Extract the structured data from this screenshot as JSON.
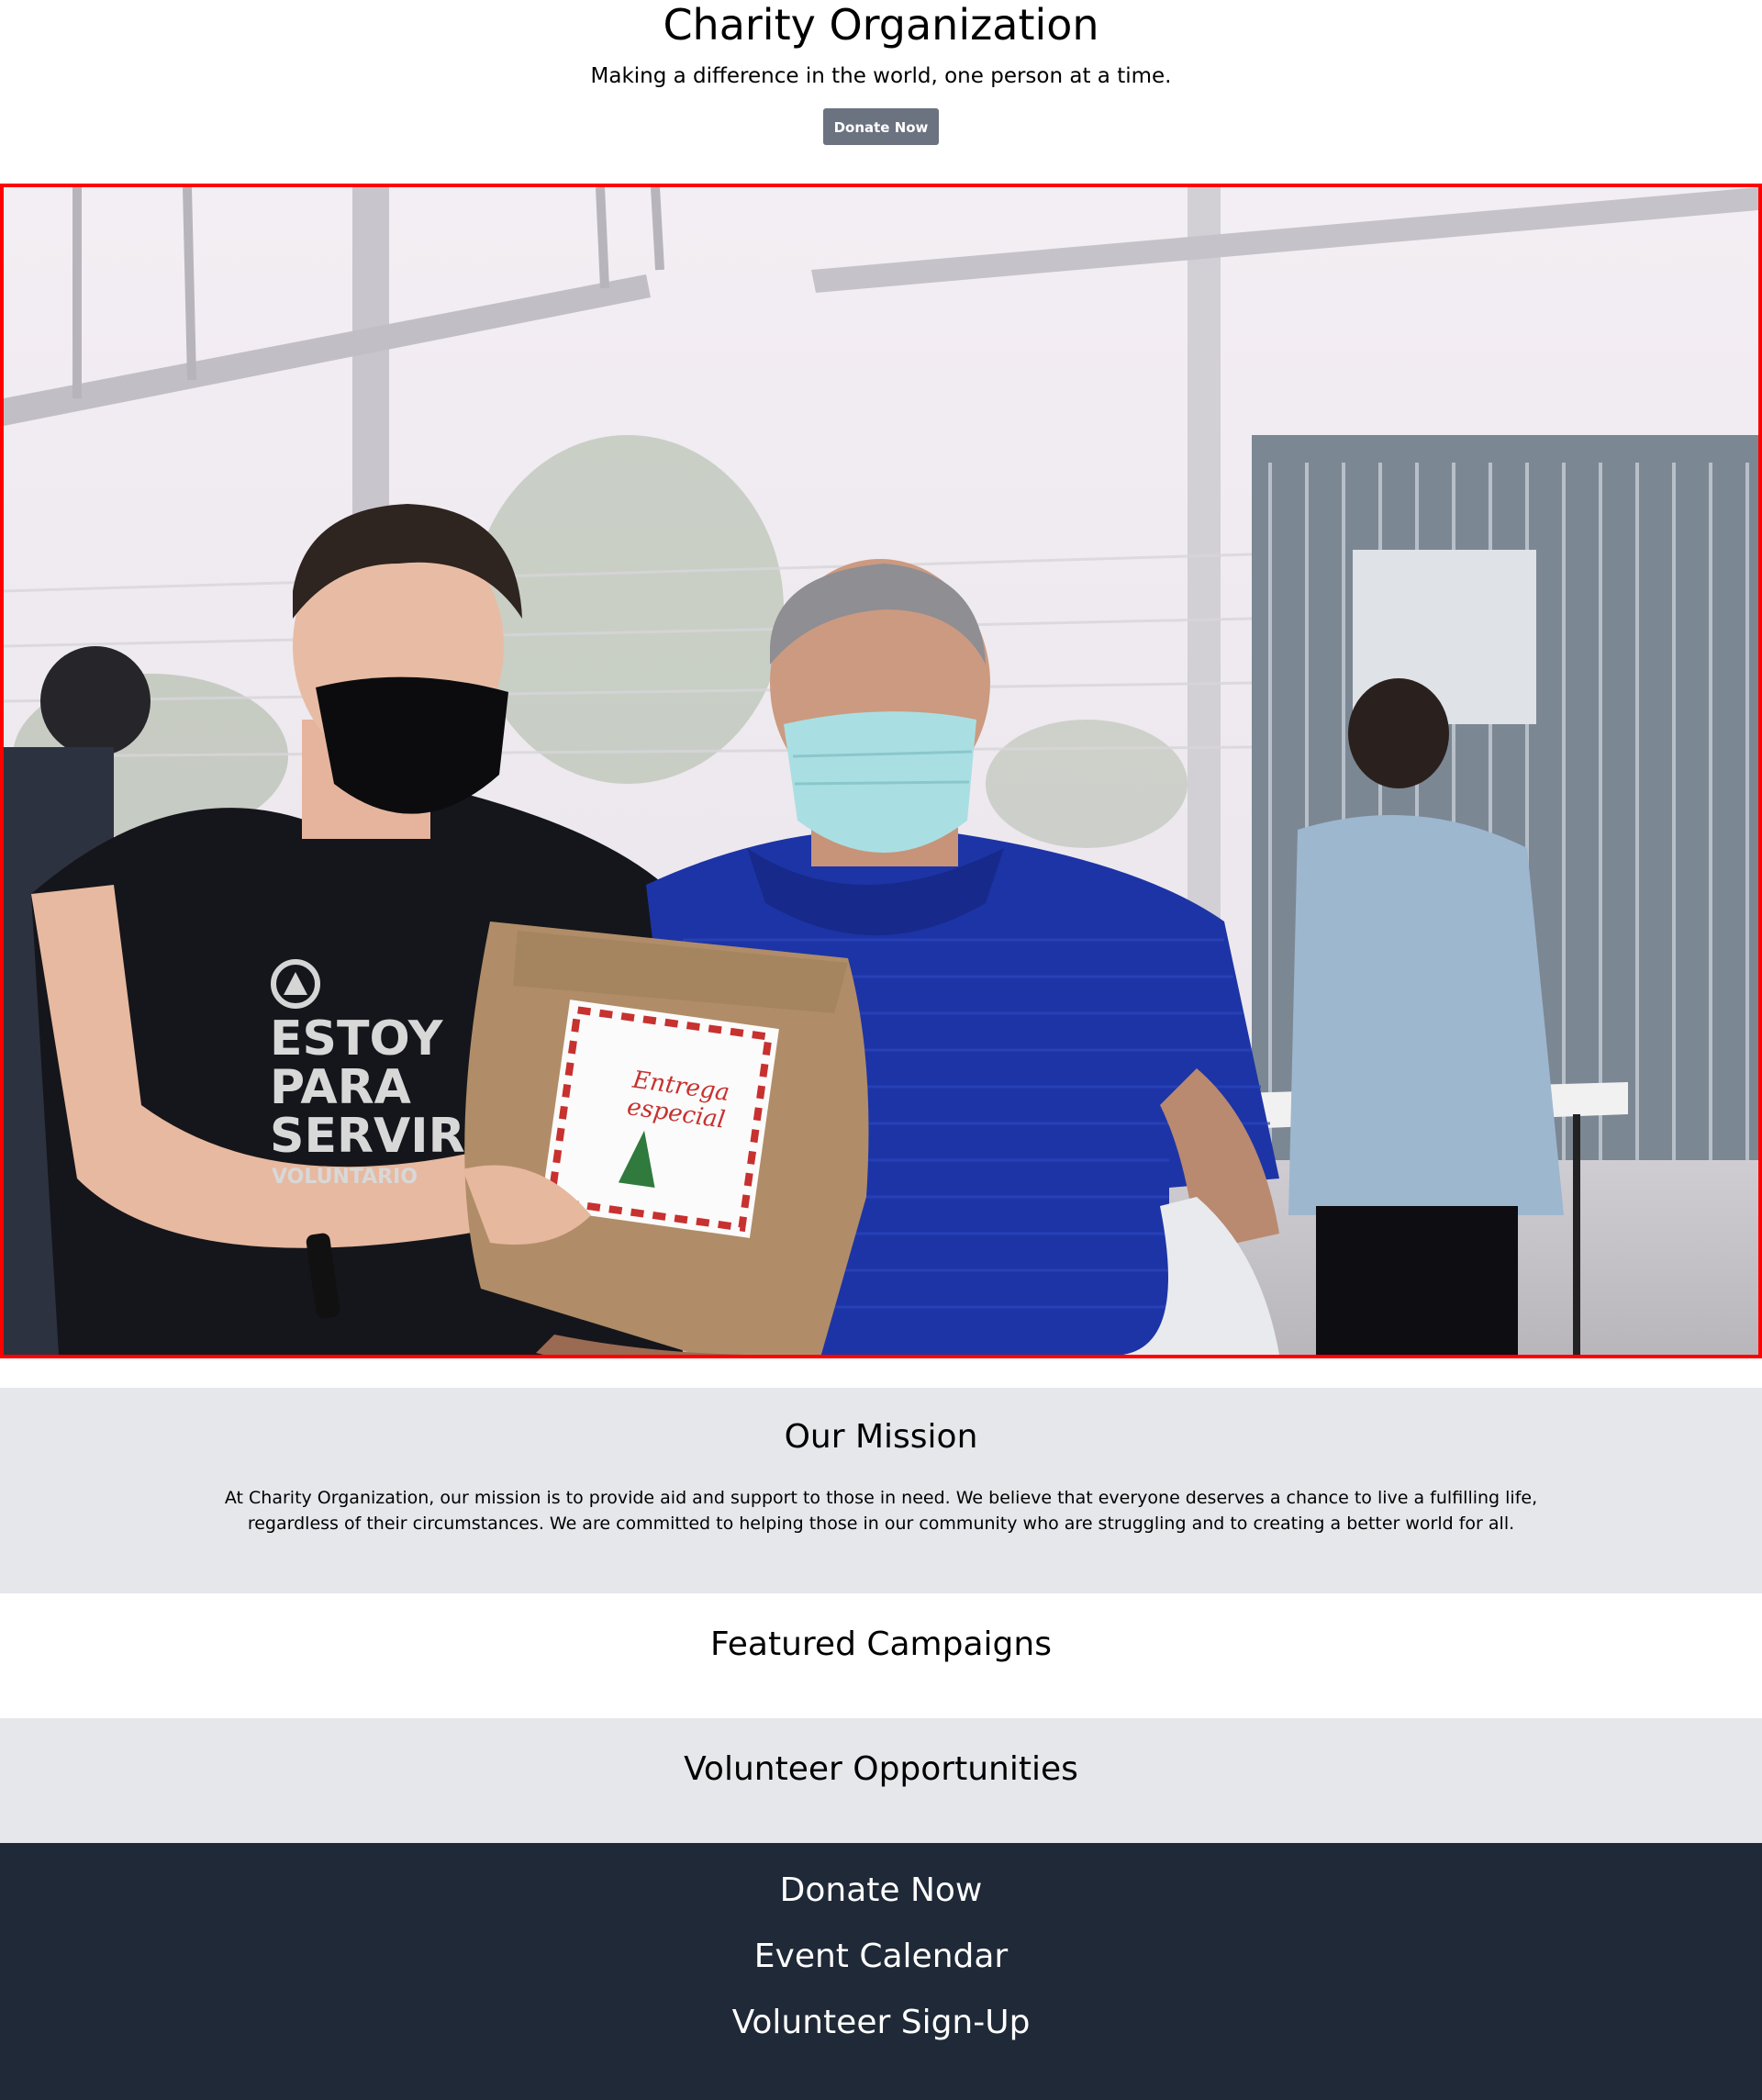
{
  "header": {
    "title": "Charity Organization",
    "tagline": "Making a difference in the world, one person at a time.",
    "donate_label": "Donate Now"
  },
  "hero": {
    "shirt_text": [
      "ESTOY",
      "PARA",
      "SERVIR",
      "VOLUNTARIO"
    ],
    "bag_label": [
      "Entrega",
      "especial"
    ],
    "border_color": "#ff0000"
  },
  "mission": {
    "heading": "Our Mission",
    "body": "At Charity Organization, our mission is to provide aid and support to those in need. We believe that everyone deserves a chance to live a fulfilling life, regardless of their circumstances. We are committed to helping those in our community who are struggling and to creating a better world for all."
  },
  "campaigns": {
    "heading": "Featured Campaigns"
  },
  "volunteer": {
    "heading": "Volunteer Opportunities"
  },
  "footer": {
    "links": [
      "Donate Now",
      "Event Calendar",
      "Volunteer Sign-Up"
    ]
  },
  "colors": {
    "button_bg": "#6b7280",
    "section_alt_bg": "#e5e7eb",
    "footer_bg": "#1f2937",
    "footer_text": "#ffffff"
  }
}
